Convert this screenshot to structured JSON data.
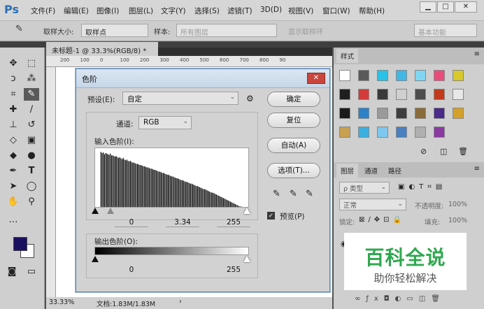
{
  "app": {
    "logo": "Ps"
  },
  "menu": [
    "文件(F)",
    "编辑(E)",
    "图像(I)",
    "图层(L)",
    "文字(Y)",
    "选择(S)",
    "滤镜(T)",
    "3D(D)",
    "视图(V)",
    "窗口(W)",
    "帮助(H)"
  ],
  "window_controls": {
    "minimize": "▁",
    "maximize": "□",
    "close": "✕"
  },
  "options": {
    "sample_size_label": "取样大小:",
    "sample_size_value": "取样点",
    "sample_label": "样本:",
    "sample_value": "所有图层",
    "show_ring": "显示取样环",
    "workspace": "基本功能"
  },
  "document": {
    "tab_title": "未标题-1 @ 33.3%(RGB/8) *",
    "tab_close": "×",
    "ruler_ticks": [
      "200",
      "100",
      "0",
      "100",
      "200",
      "300",
      "400",
      "500",
      "600",
      "700",
      "800",
      "90"
    ],
    "zoom": "33.33%",
    "doc_size": "文档:1.83M/1.83M"
  },
  "levels": {
    "title": "色阶",
    "preset_label": "预设(E):",
    "preset_value": "自定",
    "channel_label": "通道:",
    "channel_value": "RGB",
    "input_label": "输入色阶(I):",
    "input_black": "0",
    "input_gamma": "3.34",
    "input_white": "255",
    "output_label": "输出色阶(O):",
    "output_black": "0",
    "output_white": "255",
    "buttons": {
      "ok": "确定",
      "reset": "复位",
      "auto": "自动(A)",
      "options": "选项(T)..."
    },
    "preview_label": "预览(P)",
    "preview_checked": true,
    "histogram": [
      2,
      0,
      0,
      0,
      0,
      0,
      0,
      0,
      94,
      0,
      92,
      0,
      93,
      0,
      90,
      0,
      92,
      0,
      91,
      0,
      90,
      0,
      89,
      0,
      91,
      0,
      88,
      0,
      88,
      0,
      87,
      0,
      86,
      0,
      87,
      0,
      85,
      0,
      84,
      0,
      85,
      0,
      83,
      0,
      82,
      0,
      84,
      0,
      81,
      0,
      80,
      0,
      81,
      0,
      79,
      0,
      78,
      0,
      79,
      0,
      77,
      0,
      76,
      0,
      76,
      0,
      75,
      0,
      74,
      0,
      74,
      0,
      73,
      0,
      72,
      0,
      72,
      0,
      71,
      0,
      70,
      0,
      70,
      0,
      69,
      0,
      68,
      0,
      68,
      0,
      67,
      0,
      66,
      0,
      66,
      0,
      65,
      0,
      64,
      0,
      64,
      0,
      63,
      0,
      62,
      0,
      61,
      0,
      61,
      0,
      60,
      0,
      59,
      0,
      59,
      0,
      58,
      0,
      57,
      0,
      56,
      0,
      56,
      0,
      55,
      0,
      54,
      0,
      53,
      0,
      53,
      0,
      52,
      0,
      51,
      0,
      50,
      0,
      50,
      0,
      49,
      0,
      48,
      0,
      47,
      0,
      47,
      0,
      46,
      0,
      45,
      0,
      44,
      0,
      44,
      0,
      43,
      0,
      42,
      0,
      41,
      0,
      41,
      0,
      40,
      0,
      39,
      0,
      38,
      0,
      37,
      0,
      37,
      0,
      36,
      0,
      35,
      0,
      34,
      0,
      33,
      0,
      32,
      0,
      32,
      0,
      31,
      0,
      30,
      0,
      29,
      0,
      28,
      0,
      27,
      0,
      26,
      0,
      26,
      0,
      25,
      0,
      24,
      0,
      23,
      0,
      22,
      0,
      21,
      0,
      20,
      0,
      19,
      0,
      18,
      0,
      17,
      0,
      16,
      0,
      15,
      0,
      14,
      0,
      13,
      0,
      12,
      0,
      11,
      0,
      10,
      0,
      9,
      0,
      8,
      0,
      7,
      0,
      6,
      0,
      5,
      0,
      4,
      0,
      3,
      0,
      3,
      0,
      2,
      0,
      2,
      0,
      1,
      0,
      1,
      0,
      1,
      0,
      1,
      0,
      30
    ]
  },
  "swatches_panel": {
    "tab": "样式"
  },
  "layers_panel": {
    "tabs": [
      "图层",
      "通道",
      "路径"
    ],
    "kind_label": "ρ 类型",
    "blend_mode": "正常",
    "opacity_label": "不透明度:",
    "opacity_value": "100%",
    "lock_label": "锁定:",
    "fill_label": "填充:",
    "fill_value": "100%"
  },
  "colors": {
    "foreground": "#1a1060",
    "background": "#ffffff",
    "style_swatches": [
      "#ffffff",
      "#5a5a5a",
      "#2ac1e8",
      "#41b7e6",
      "#7fd6f2",
      "#e94c7a",
      "#d8c82a",
      "#1f1f1f",
      "#d43b3b",
      "#3a3a3a",
      "#cfcfcf",
      "#4d4d4d",
      "#c23a1b",
      "#e8e8e8",
      "#1b1b1b",
      "#2b82c8",
      "#9a9a9a",
      "#3f3f3f",
      "#8a6b3a",
      "#4a2a8a",
      "#d4a02a",
      "#c8a050",
      "#3ab0e0",
      "#7ec8f0",
      "#4a80c0",
      "#b0b0b0",
      "#8a3aa0"
    ]
  },
  "watermark": {
    "line1": "百科全说",
    "line2": "助你轻松解决"
  }
}
